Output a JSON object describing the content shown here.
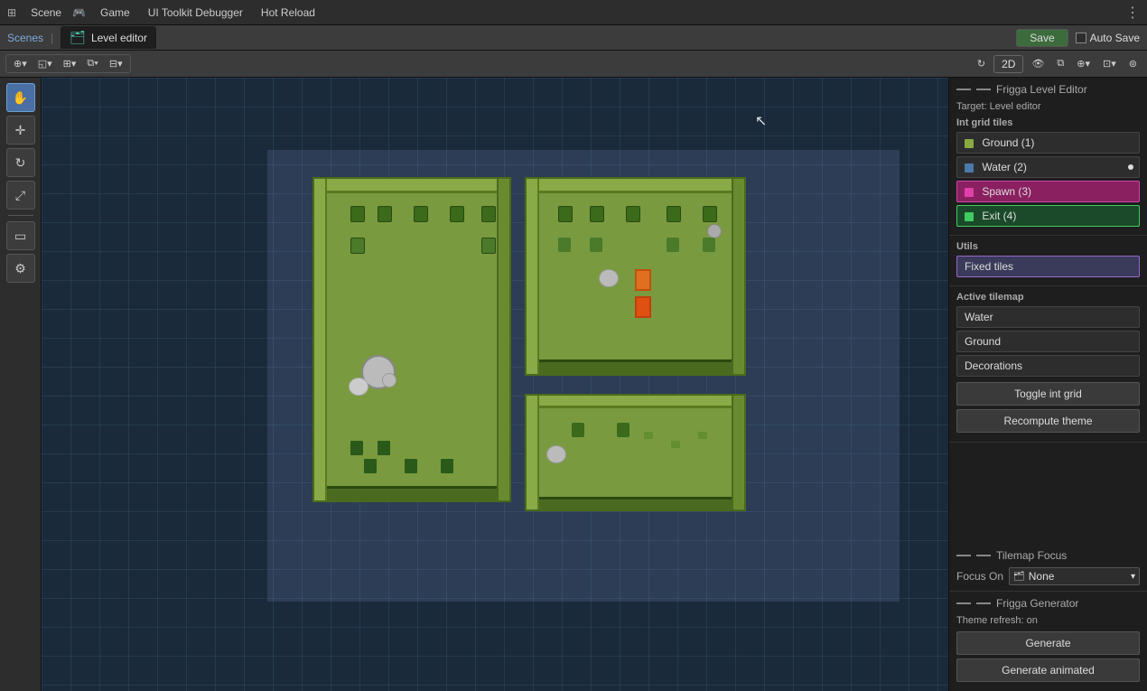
{
  "menu": {
    "scene_label": "Scene",
    "game_label": "Game",
    "uitoolkit_label": "UI Toolkit Debugger",
    "hotreload_label": "Hot Reload"
  },
  "tabbar": {
    "scenes_label": "Scenes",
    "tab_label": "Level editor",
    "save_label": "Save",
    "autosave_label": "Auto Save"
  },
  "toolbar": {
    "btn_2d": "2D"
  },
  "left_tools": {
    "hand": "✋",
    "move": "✛",
    "rotate": "↻",
    "scale": "⤢",
    "rect": "▭",
    "settings": "⚙"
  },
  "right_panel": {
    "editor_title": "Frigga Level Editor",
    "target_label": "Target: Level editor",
    "int_grid_tiles_label": "Int grid tiles",
    "tiles": [
      {
        "label": "Ground (1)",
        "color": "#8aaa40",
        "active": false,
        "dot": false
      },
      {
        "label": "Water (2)",
        "color": "#4a7aaa",
        "active": false,
        "dot": true
      },
      {
        "label": "Spawn (3)",
        "color": "#e040aa",
        "active": false,
        "dot": false
      },
      {
        "label": "Exit (4)",
        "color": "#40cc60",
        "active": false,
        "dot": false
      }
    ],
    "utils_label": "Utils",
    "fixed_tiles_label": "Fixed tiles",
    "active_tilemap_label": "Active tilemap",
    "tilemaps": [
      {
        "label": "Water"
      },
      {
        "label": "Ground"
      },
      {
        "label": "Decorations"
      }
    ],
    "toggle_int_grid_label": "Toggle int grid",
    "recompute_theme_label": "Recompute theme",
    "tilemap_focus_title": "Tilemap Focus",
    "focus_on_label": "Focus On",
    "focus_value": "None",
    "generator_title": "Frigga Generator",
    "theme_refresh_label": "Theme refresh: on",
    "generate_label": "Generate",
    "generate_animated_label": "Generate animated"
  }
}
